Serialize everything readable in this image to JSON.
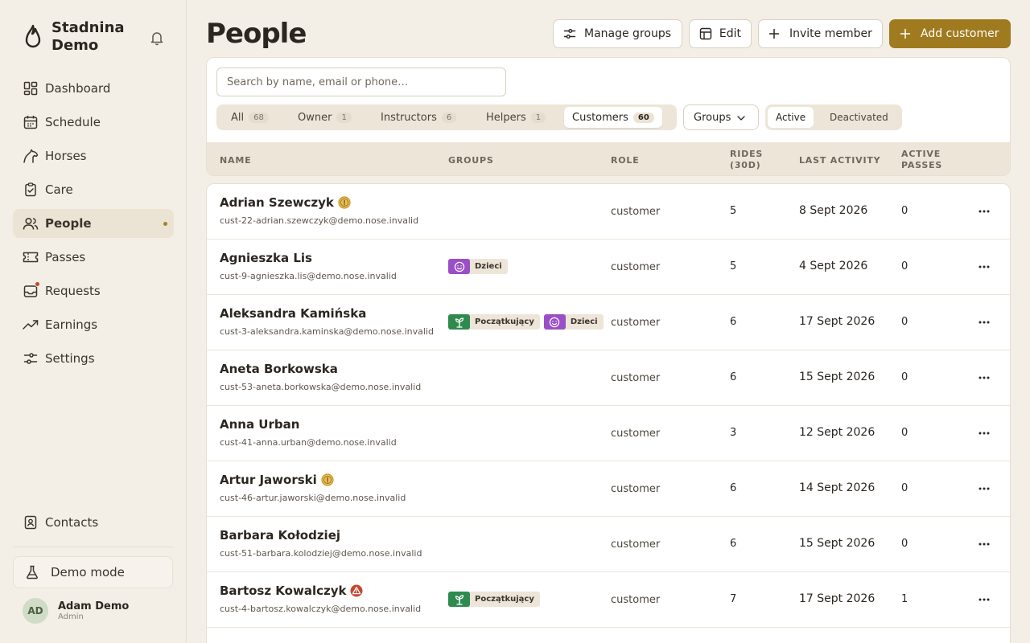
{
  "brand": {
    "name": "Stadnina Demo"
  },
  "nav": [
    {
      "label": "Dashboard",
      "icon": "dashboard-icon"
    },
    {
      "label": "Schedule",
      "icon": "calendar-icon"
    },
    {
      "label": "Horses",
      "icon": "horse-icon"
    },
    {
      "label": "Care",
      "icon": "clipboard-icon"
    },
    {
      "label": "People",
      "icon": "people-icon",
      "active": true
    },
    {
      "label": "Passes",
      "icon": "ticket-icon"
    },
    {
      "label": "Requests",
      "icon": "inbox-icon"
    },
    {
      "label": "Earnings",
      "icon": "trend-up-icon"
    },
    {
      "label": "Settings",
      "icon": "sliders-icon"
    }
  ],
  "sidebar_footer": {
    "contacts": "Contacts",
    "demo_mode": "Demo mode",
    "user": {
      "initials": "AD",
      "name": "Adam Demo",
      "role": "Admin"
    }
  },
  "header": {
    "title": "People",
    "manage_groups": "Manage groups",
    "edit": "Edit",
    "invite_member": "Invite member",
    "add_customer": "Add customer"
  },
  "filters": {
    "search_placeholder": "Search by name, email or phone…",
    "tabs": [
      {
        "label": "All",
        "count": "68"
      },
      {
        "label": "Owner",
        "count": "1"
      },
      {
        "label": "Instructors",
        "count": "6"
      },
      {
        "label": "Helpers",
        "count": "1"
      },
      {
        "label": "Customers",
        "count": "60",
        "active": true
      }
    ],
    "groups_label": "Groups",
    "status": {
      "active": "Active",
      "deactivated": "Deactivated"
    }
  },
  "columns": {
    "name": "NAME",
    "groups": "GROUPS",
    "role": "ROLE",
    "rides": "RIDES (30D)",
    "last_activity": "LAST ACTIVITY",
    "active_passes": "ACTIVE PASSES"
  },
  "colors": {
    "accent": "#a07a1f",
    "group_green": "#2f8a4f",
    "group_purple": "#9a4fc7",
    "warn": "#c8462f",
    "info_gold": "#c9961f"
  },
  "rows": [
    {
      "name": "Adrian Szewczyk",
      "flag": "info-gold-icon",
      "email": "cust-22-adrian.szewczyk@demo.nose.invalid",
      "groups": [],
      "role": "customer",
      "rides": "5",
      "last": "8 Sept 2026",
      "passes": "0"
    },
    {
      "name": "Agnieszka Lis",
      "flag": "",
      "email": "cust-9-agnieszka.lis@demo.nose.invalid",
      "groups": [
        {
          "label": "Dzieci",
          "kind": "purple"
        }
      ],
      "role": "customer",
      "rides": "5",
      "last": "4 Sept 2026",
      "passes": "0"
    },
    {
      "name": "Aleksandra Kamińska",
      "flag": "",
      "email": "cust-3-aleksandra.kaminska@demo.nose.invalid",
      "groups": [
        {
          "label": "Początkujący",
          "kind": "green"
        },
        {
          "label": "Dzieci",
          "kind": "purple"
        }
      ],
      "role": "customer",
      "rides": "6",
      "last": "17 Sept 2026",
      "passes": "0"
    },
    {
      "name": "Aneta Borkowska",
      "flag": "",
      "email": "cust-53-aneta.borkowska@demo.nose.invalid",
      "groups": [],
      "role": "customer",
      "rides": "6",
      "last": "15 Sept 2026",
      "passes": "0"
    },
    {
      "name": "Anna Urban",
      "flag": "",
      "email": "cust-41-anna.urban@demo.nose.invalid",
      "groups": [],
      "role": "customer",
      "rides": "3",
      "last": "12 Sept 2026",
      "passes": "0"
    },
    {
      "name": "Artur Jaworski",
      "flag": "info-gold-icon",
      "email": "cust-46-artur.jaworski@demo.nose.invalid",
      "groups": [],
      "role": "customer",
      "rides": "6",
      "last": "14 Sept 2026",
      "passes": "0"
    },
    {
      "name": "Barbara Kołodziej",
      "flag": "",
      "email": "cust-51-barbara.kolodziej@demo.nose.invalid",
      "groups": [],
      "role": "customer",
      "rides": "6",
      "last": "15 Sept 2026",
      "passes": "0"
    },
    {
      "name": "Bartosz Kowalczyk",
      "flag": "warning-red-icon",
      "email": "cust-4-bartosz.kowalczyk@demo.nose.invalid",
      "groups": [
        {
          "label": "Początkujący",
          "kind": "green"
        }
      ],
      "role": "customer",
      "rides": "7",
      "last": "17 Sept 2026",
      "passes": "1"
    }
  ]
}
